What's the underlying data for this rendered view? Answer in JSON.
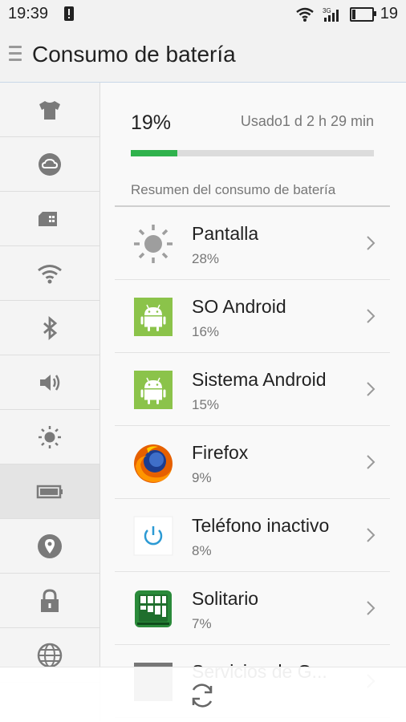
{
  "status_bar": {
    "time": "19:39",
    "network": "3G",
    "battery_level": "19"
  },
  "header": {
    "title": "Consumo de batería"
  },
  "rail": {
    "items": [
      {
        "icon": "shirt-icon",
        "name": "rail-item-themes"
      },
      {
        "icon": "cloud-account-icon",
        "name": "rail-item-account"
      },
      {
        "icon": "sim-card-icon",
        "name": "rail-item-sim"
      },
      {
        "icon": "wifi-icon",
        "name": "rail-item-wifi"
      },
      {
        "icon": "bluetooth-icon",
        "name": "rail-item-bluetooth"
      },
      {
        "icon": "speaker-icon",
        "name": "rail-item-sound"
      },
      {
        "icon": "brightness-icon",
        "name": "rail-item-display"
      },
      {
        "icon": "battery-icon",
        "name": "rail-item-battery"
      },
      {
        "icon": "location-icon",
        "name": "rail-item-location"
      },
      {
        "icon": "lock-icon",
        "name": "rail-item-security"
      },
      {
        "icon": "globe-icon",
        "name": "rail-item-language"
      }
    ]
  },
  "battery": {
    "percent": "19%",
    "level": 0.19,
    "used_label": "Usado",
    "used_value": "1 d 2 h 29 min",
    "accent": "#2fb24c"
  },
  "summary": {
    "label": "Resumen del consumo de batería",
    "items": [
      {
        "name": "Pantalla",
        "percent": "28%",
        "icon": "brightness-icon"
      },
      {
        "name": "SO Android",
        "percent": "16%",
        "icon": "android-icon"
      },
      {
        "name": "Sistema Android",
        "percent": "15%",
        "icon": "android-icon"
      },
      {
        "name": "Firefox",
        "percent": "9%",
        "icon": "firefox-icon"
      },
      {
        "name": "Teléfono inactivo",
        "percent": "8%",
        "icon": "power-icon"
      },
      {
        "name": "Solitario",
        "percent": "7%",
        "icon": "solitaire-icon"
      },
      {
        "name": "Servicios de G...",
        "percent": "",
        "icon": "app-icon"
      }
    ]
  },
  "bottom_bar": {
    "icon": "refresh-icon"
  }
}
